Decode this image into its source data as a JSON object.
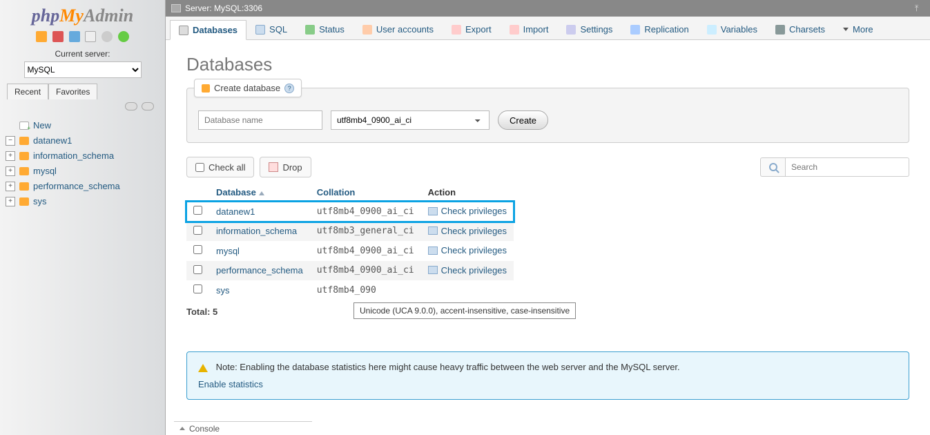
{
  "logo": {
    "p1": "php",
    "p2": "My",
    "p3": "Admin"
  },
  "sidebar": {
    "server_label": "Current server:",
    "server_value": "MySQL",
    "tabs": {
      "recent": "Recent",
      "favorites": "Favorites"
    },
    "new_label": "New",
    "tree": [
      {
        "name": "datanew1"
      },
      {
        "name": "information_schema"
      },
      {
        "name": "mysql"
      },
      {
        "name": "performance_schema"
      },
      {
        "name": "sys"
      }
    ]
  },
  "topbar": {
    "server": "Server: MySQL:3306"
  },
  "tabs": {
    "databases": "Databases",
    "sql": "SQL",
    "status": "Status",
    "users": "User accounts",
    "export": "Export",
    "import": "Import",
    "settings": "Settings",
    "replication": "Replication",
    "variables": "Variables",
    "charsets": "Charsets",
    "more": "More"
  },
  "page": {
    "title": "Databases",
    "legend": "Create database",
    "dbname_placeholder": "Database name",
    "collation_value": "utf8mb4_0900_ai_ci",
    "create_btn": "Create",
    "check_all": "Check all",
    "drop": "Drop",
    "search_placeholder": "Search",
    "headers": {
      "database": "Database",
      "collation": "Collation",
      "action": "Action"
    },
    "rows": [
      {
        "db": "datanew1",
        "coll": "utf8mb4_0900_ai_ci",
        "priv": "Check privileges",
        "highlight": true,
        "even": false
      },
      {
        "db": "information_schema",
        "coll": "utf8mb3_general_ci",
        "priv": "Check privileges",
        "highlight": false,
        "even": true
      },
      {
        "db": "mysql",
        "coll": "utf8mb4_0900_ai_ci",
        "priv": "Check privileges",
        "highlight": false,
        "even": false
      },
      {
        "db": "performance_schema",
        "coll": "utf8mb4_0900_ai_ci",
        "priv": "Check privileges",
        "highlight": false,
        "even": true
      },
      {
        "db": "sys",
        "coll": "utf8mb4_090",
        "priv": "",
        "highlight": false,
        "even": false
      }
    ],
    "total": "Total: 5",
    "tooltip": "Unicode (UCA 9.0.0), accent-insensitive, case-insensitive",
    "note": "Note: Enabling the database statistics here might cause heavy traffic between the web server and the MySQL server.",
    "enable_stats": "Enable statistics"
  },
  "console": "Console"
}
